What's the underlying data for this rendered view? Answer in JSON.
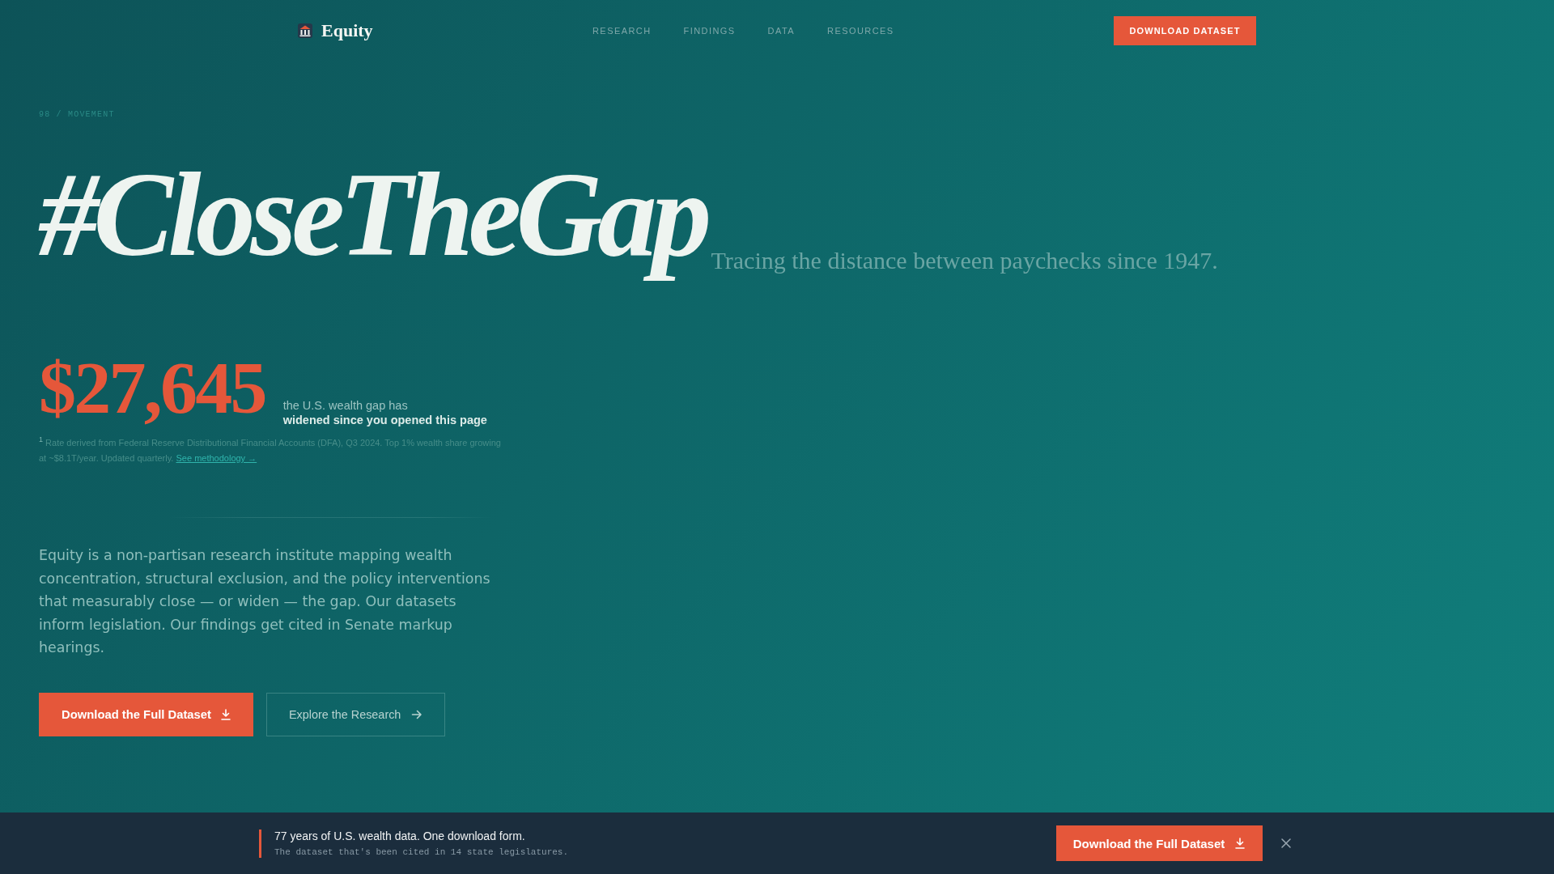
{
  "nav": {
    "brand": "Equity",
    "links": [
      "RESEARCH",
      "FINDINGS",
      "DATA",
      "RESOURCES"
    ],
    "cta": "DOWNLOAD DATASET"
  },
  "hero": {
    "breadcrumb": "98 / MOVEMENT",
    "headline": "#CloseTheGap",
    "tagline": "Tracing the distance between paychecks since 1947.",
    "stat": {
      "value": "$27,645",
      "caption": "the U.S. wealth gap has **widened since you opened this page**"
    },
    "footnote": {
      "text": "$^{1}$ Rate derived from Federal Reserve Distributional Financial Accounts (DFA), Q3 2024. Top 1% wealth share growing at ~$8.1T/year. Updated quarterly.",
      "link": "See methodology →"
    },
    "intro": "Equity is a non-partisan research institute mapping wealth concentration, structural exclusion, and the policy interventions that measurably close — or widen — the gap. Our datasets inform legislation. Our findings get cited in Senate markup hearings.",
    "buttons": [
      {
        "kind": "primary",
        "label": "Download the Full Dataset"
      },
      {
        "kind": "secondary",
        "label": "Explore the Research"
      }
    ]
  },
  "banner": {
    "title": "77 years of U.S. wealth data. One download form.",
    "subtitle": "The dataset that's been cited in 14 state legislatures.",
    "button": "Download the Full Dataset"
  }
}
